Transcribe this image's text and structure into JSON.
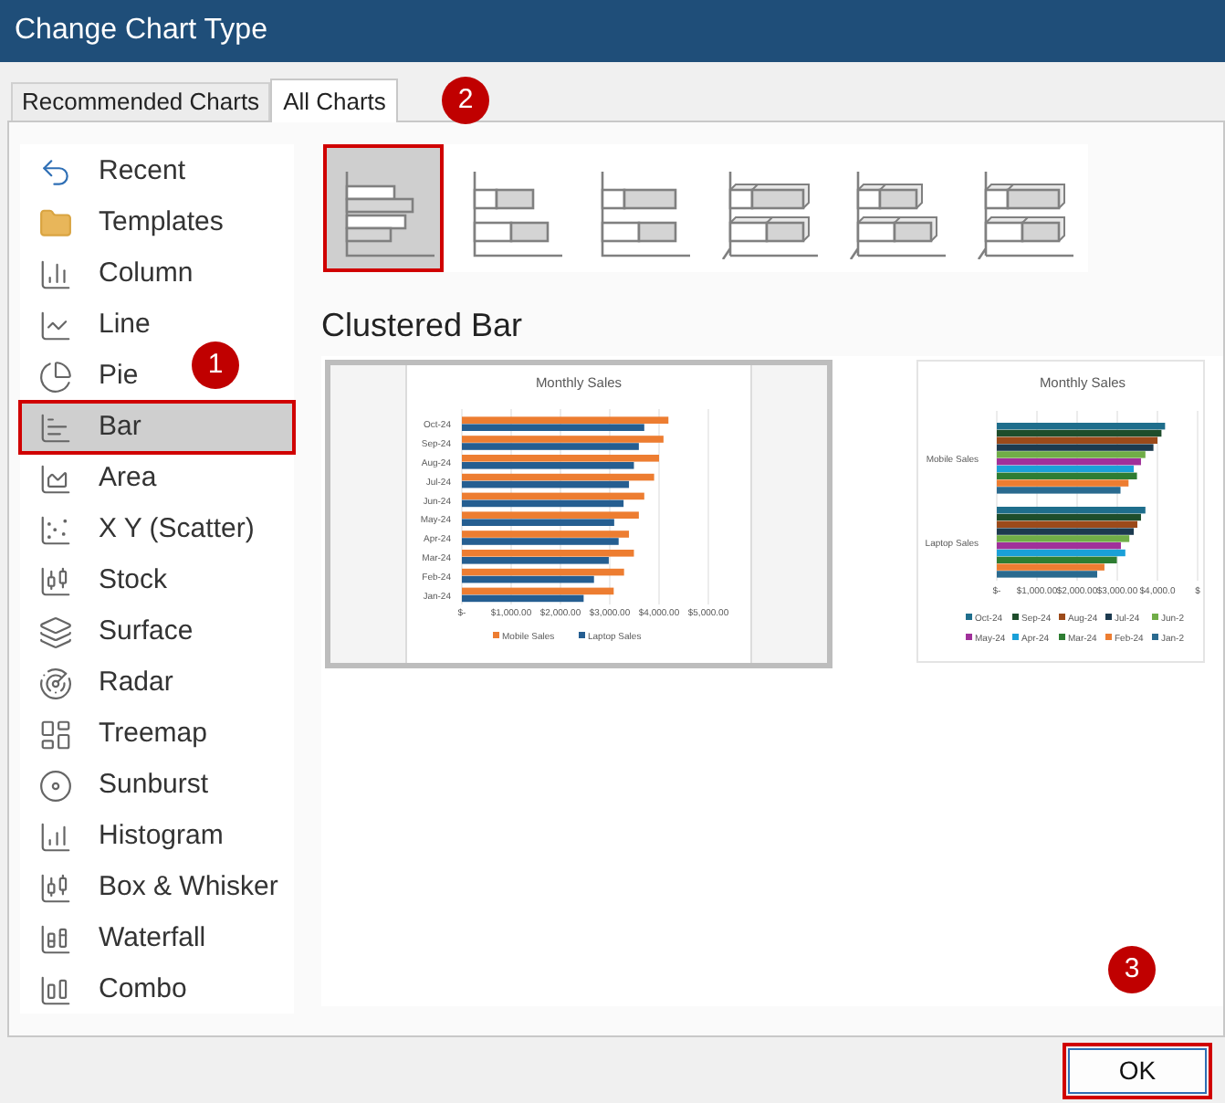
{
  "window": {
    "title": "Change Chart Type"
  },
  "tabs": [
    {
      "label": "Recommended Charts",
      "selected": false
    },
    {
      "label": "All Charts",
      "selected": true
    }
  ],
  "chart_types": [
    {
      "label": "Recent",
      "selected": false,
      "highlighted": false
    },
    {
      "label": "Templates",
      "selected": false,
      "highlighted": false
    },
    {
      "label": "Column",
      "selected": false,
      "highlighted": false
    },
    {
      "label": "Line",
      "selected": false,
      "highlighted": false
    },
    {
      "label": "Pie",
      "selected": false,
      "highlighted": false
    },
    {
      "label": "Bar",
      "selected": true,
      "highlighted": true
    },
    {
      "label": "Area",
      "selected": false,
      "highlighted": false
    },
    {
      "label": "X Y (Scatter)",
      "selected": false,
      "highlighted": false
    },
    {
      "label": "Stock",
      "selected": false,
      "highlighted": false
    },
    {
      "label": "Surface",
      "selected": false,
      "highlighted": false
    },
    {
      "label": "Radar",
      "selected": false,
      "highlighted": false
    },
    {
      "label": "Treemap",
      "selected": false,
      "highlighted": false
    },
    {
      "label": "Sunburst",
      "selected": false,
      "highlighted": false
    },
    {
      "label": "Histogram",
      "selected": false,
      "highlighted": false
    },
    {
      "label": "Box & Whisker",
      "selected": false,
      "highlighted": false
    },
    {
      "label": "Waterfall",
      "selected": false,
      "highlighted": false
    },
    {
      "label": "Combo",
      "selected": false,
      "highlighted": false
    }
  ],
  "subtypes": [
    {
      "selected": true,
      "highlighted": true
    },
    {
      "selected": false,
      "highlighted": false
    },
    {
      "selected": false,
      "highlighted": false
    },
    {
      "selected": false,
      "highlighted": false
    },
    {
      "selected": false,
      "highlighted": false
    },
    {
      "selected": false,
      "highlighted": false
    }
  ],
  "subtype_title": "Clustered Bar",
  "previews": [
    {
      "selected": true,
      "chart_data": {
        "type": "bar",
        "orientation": "horizontal",
        "title": "Monthly Sales",
        "categories": [
          "Oct-24",
          "Sep-24",
          "Aug-24",
          "Jul-24",
          "Jun-24",
          "May-24",
          "Apr-24",
          "Mar-24",
          "Feb-24",
          "Jan-24"
        ],
        "series": [
          {
            "name": "Mobile Sales",
            "color": "#ed7d31",
            "values": [
              4190,
              4090,
              4000,
              3900,
              3700,
              3590,
              3390,
              3490,
              3290,
              3080
            ]
          },
          {
            "name": "Laptop Sales",
            "color": "#255e91",
            "values": [
              3700,
              3590,
              3490,
              3390,
              3280,
              3090,
              3180,
              2980,
              2680,
              2470
            ]
          }
        ],
        "xlim": [
          0,
          5000
        ],
        "grid": true,
        "legend": "bottom",
        "xticks": [
          {
            "value": 0,
            "label": "$-"
          },
          {
            "value": 1000,
            "label": "$1,000.00"
          },
          {
            "value": 2000,
            "label": "$2,000.00"
          },
          {
            "value": 3000,
            "label": "$3,000.00"
          },
          {
            "value": 4000,
            "label": "$4,000.00"
          },
          {
            "value": 5000,
            "label": "$5,000.00"
          }
        ]
      }
    },
    {
      "selected": false,
      "chart_data": {
        "type": "bar",
        "orientation": "horizontal",
        "title": "Monthly Sales",
        "categories": [
          "Mobile Sales",
          "Laptop Sales"
        ],
        "series": [
          {
            "name": "Oct-24",
            "color": "#1f6e8c",
            "values": [
              4190,
              3700
            ]
          },
          {
            "name": "Sep-24",
            "color": "#1e4d2b",
            "values": [
              4100,
              3590
            ]
          },
          {
            "name": "Aug-24",
            "color": "#9c4a1a",
            "values": [
              4000,
              3500
            ]
          },
          {
            "name": "Jul-24",
            "color": "#1c3a4f",
            "values": [
              3900,
              3410
            ]
          },
          {
            "name": "Jun-2",
            "color": "#70ad47",
            "values": [
              3700,
              3300
            ]
          },
          {
            "name": "May-24",
            "color": "#a0309a",
            "values": [
              3590,
              3090
            ]
          },
          {
            "name": "Apr-24",
            "color": "#1aa0d8",
            "values": [
              3410,
              3200
            ]
          },
          {
            "name": "Mar-24",
            "color": "#2e7d32",
            "values": [
              3490,
              2990
            ]
          },
          {
            "name": "Feb-24",
            "color": "#ed7d31",
            "values": [
              3280,
              2680
            ]
          },
          {
            "name": "Jan-2",
            "color": "#2a6a8f",
            "values": [
              3080,
              2500
            ]
          }
        ],
        "xlim": [
          0,
          5000
        ],
        "grid": true,
        "legend": "bottom",
        "xticks": [
          {
            "value": 0,
            "label": "$-"
          },
          {
            "value": 1000,
            "label": "$1,000.00"
          },
          {
            "value": 2000,
            "label": "$2,000.00"
          },
          {
            "value": 3000,
            "label": "$3,000.00"
          },
          {
            "value": 4000,
            "label": "$4,000.0"
          },
          {
            "value": 5000,
            "label": "$"
          }
        ]
      }
    }
  ],
  "buttons": [
    {
      "label": "OK",
      "highlighted": true
    }
  ],
  "annotations": [
    {
      "label": "1"
    },
    {
      "label": "2"
    },
    {
      "label": "3"
    }
  ]
}
